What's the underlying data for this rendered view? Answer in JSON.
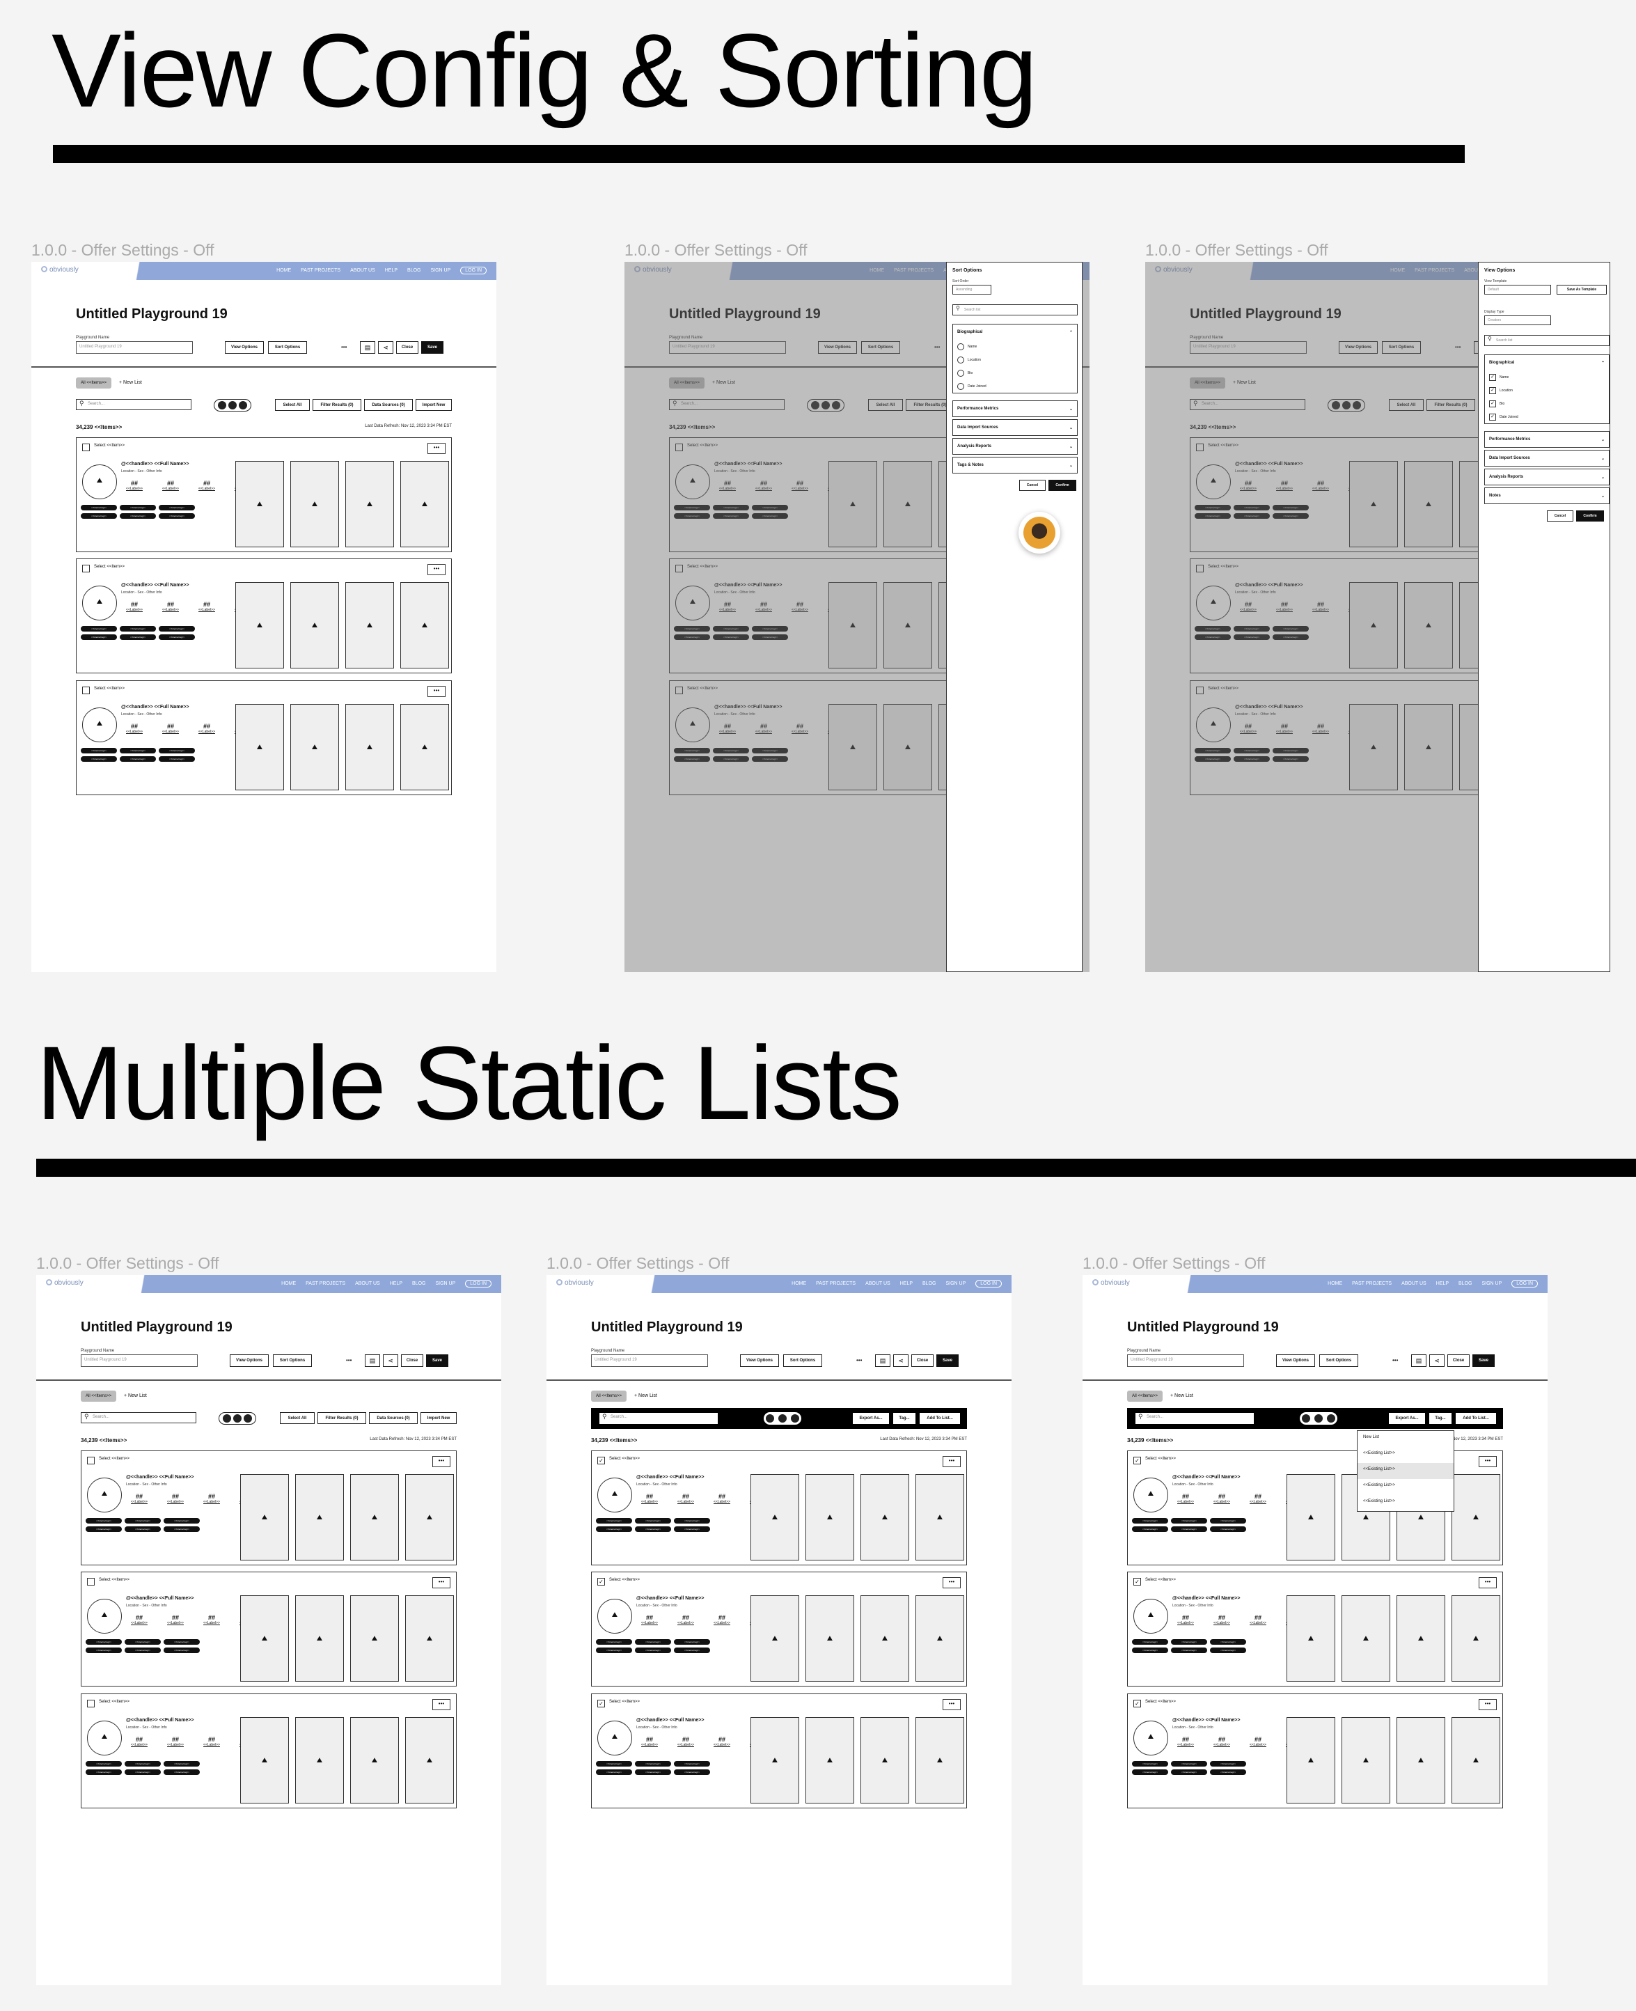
{
  "sections": {
    "view_config_title": "View Config & Sorting",
    "static_lists_title": "Multiple Static Lists"
  },
  "frame_label": "1.0.0 - Offer Settings - Off",
  "nav": {
    "logo": "obviously",
    "links": [
      "HOME",
      "PAST PROJECTS",
      "ABOUT US",
      "HELP",
      "BLOG",
      "SIGN UP",
      "LOG IN"
    ]
  },
  "page": {
    "title": "Untitled Playground 19",
    "name_label": "Playground Name",
    "name_placeholder": "Untitled Playground 19",
    "view_options": "View Options",
    "sort_options": "Sort Options",
    "more": "•••",
    "close": "Close",
    "save": "Save"
  },
  "list_tabs": {
    "all": "All <<Items>>",
    "new_list": "+ New List"
  },
  "toolbar": {
    "search_placeholder": "Search...",
    "select_all": "Select All",
    "filter_results": "Filter Results (0)",
    "data_sources": "Data Sources (0)",
    "import_new": "Import New"
  },
  "bulk_toolbar": {
    "export": "Export As...",
    "tag": "Tag...",
    "add_to_list": "Add To List..."
  },
  "results": {
    "count": "34,239 <<Items>>",
    "refresh": "Last Data Refresh: Nov 12, 2023 3:34 PM EST"
  },
  "card": {
    "select": "Select <<Item>>",
    "menu": "•••",
    "handle": "@<<handle>> <<Full Name>>",
    "location": "Location - Sex - Other Info",
    "stat_value": "##",
    "stat_label": "<<Label>>",
    "tag": "<<Internal tag>>"
  },
  "sort_panel": {
    "title": "Sort Options",
    "sort_order_label": "Sort Order",
    "sort_order_value": "Ascending",
    "search_placeholder": "Search list",
    "biographical": "Biographical",
    "fields": [
      "Name",
      "Location",
      "Bio",
      "Date Joined"
    ],
    "sections": [
      "Performance Metrics",
      "Data Import Sources",
      "Analysis Reports",
      "Tags & Notes"
    ],
    "cancel": "Cancel",
    "confirm": "Confirm"
  },
  "view_panel": {
    "title": "View Options",
    "template_label": "View Template",
    "template_value": "Default",
    "save_template": "Save As Template",
    "display_label": "Display Type",
    "display_value": "Creators",
    "search_placeholder": "Search list",
    "biographical": "Biographical",
    "fields": [
      "Name",
      "Location",
      "Bio",
      "Date Joined"
    ],
    "sections": [
      "Performance Metrics",
      "Data Import Sources",
      "Analysis Reports",
      "Notes"
    ],
    "cancel": "Cancel",
    "confirm": "Confirm"
  },
  "add_to_list_menu": {
    "items": [
      "New List",
      "<<Existing List>>",
      "<<Existing List>>",
      "<<Existing List>>",
      "<<Existing List>>"
    ]
  }
}
